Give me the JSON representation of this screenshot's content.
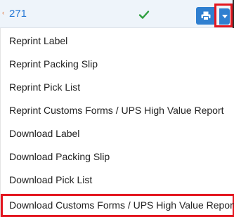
{
  "row": {
    "number": "271",
    "caret": "‹",
    "status_icon": "check-icon",
    "print_icon": "printer-icon",
    "dropdown_icon": "caret-down-icon"
  },
  "menu": {
    "items": [
      {
        "label": "Reprint Label"
      },
      {
        "label": "Reprint Packing Slip"
      },
      {
        "label": "Reprint Pick List"
      },
      {
        "label": "Reprint Customs Forms / UPS High Value Report"
      },
      {
        "label": "Download Label"
      },
      {
        "label": "Download Packing Slip"
      },
      {
        "label": "Download Pick List"
      },
      {
        "label": "Download Customs Forms / UPS High Value Report"
      }
    ]
  },
  "colors": {
    "accent_blue": "#2f7fd0",
    "highlight_red": "#e3161f",
    "success_green": "#2e9e3e"
  }
}
